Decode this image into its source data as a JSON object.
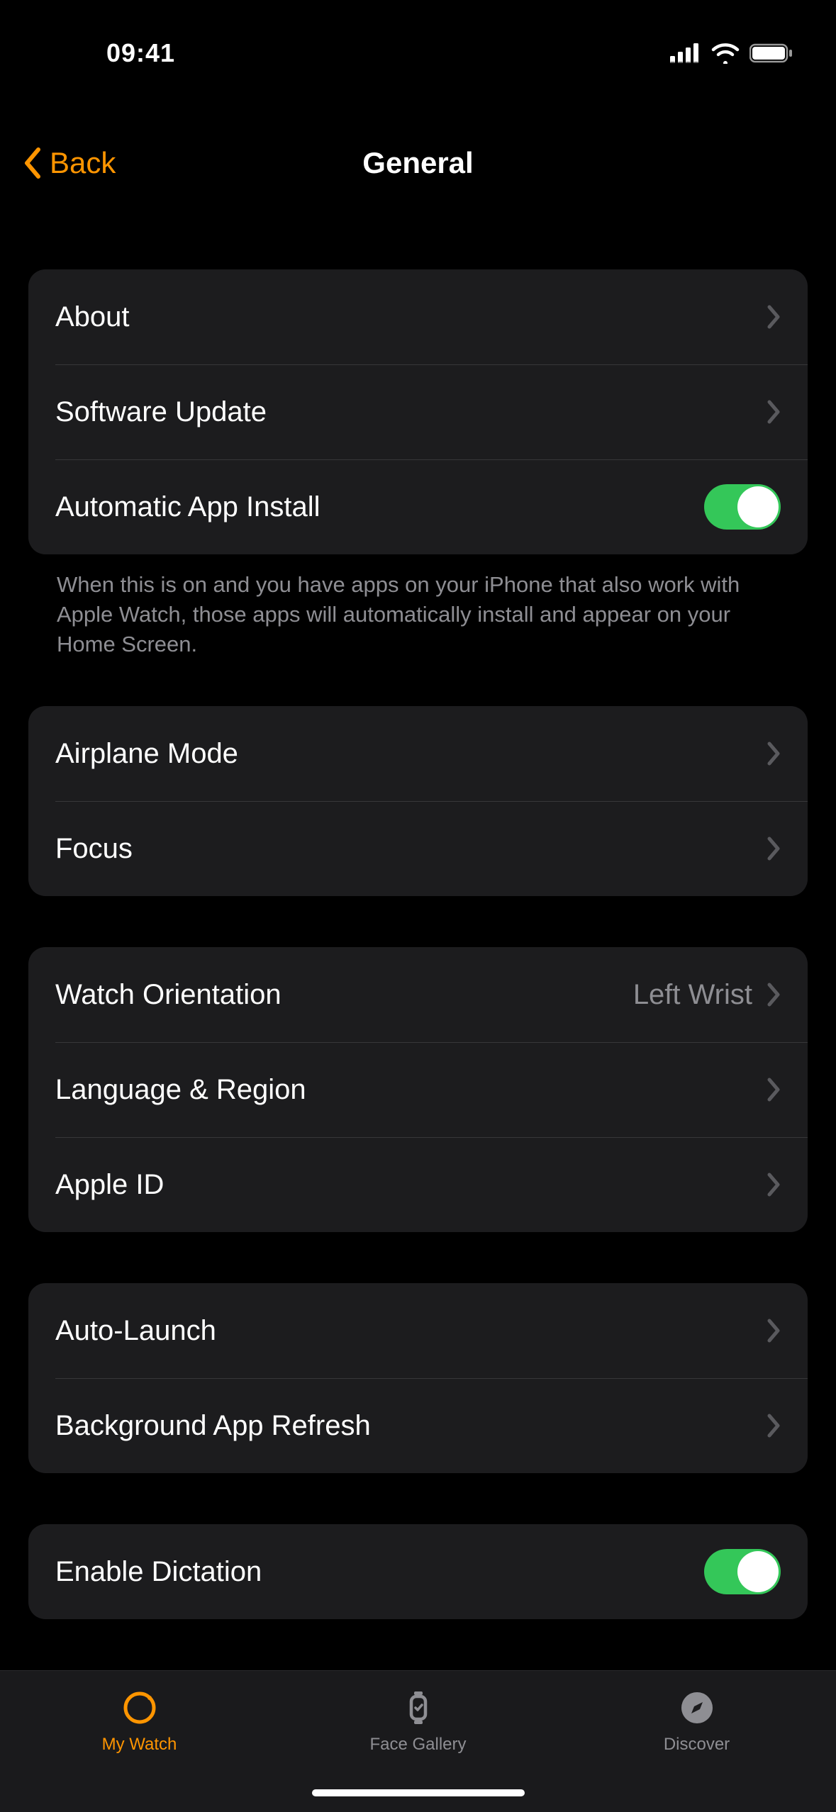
{
  "status": {
    "time": "09:41"
  },
  "nav": {
    "back": "Back",
    "title": "General"
  },
  "groups": [
    {
      "rows": [
        {
          "key": "about",
          "label": "About",
          "type": "nav"
        },
        {
          "key": "software-update",
          "label": "Software Update",
          "type": "nav"
        },
        {
          "key": "auto-app-install",
          "label": "Automatic App Install",
          "type": "toggle",
          "on": true
        }
      ],
      "footer": "When this is on and you have apps on your iPhone that also work with Apple Watch, those apps will automatically install and appear on your Home Screen."
    },
    {
      "rows": [
        {
          "key": "airplane-mode",
          "label": "Airplane Mode",
          "type": "nav"
        },
        {
          "key": "focus",
          "label": "Focus",
          "type": "nav"
        }
      ]
    },
    {
      "rows": [
        {
          "key": "watch-orientation",
          "label": "Watch Orientation",
          "type": "nav",
          "value": "Left Wrist"
        },
        {
          "key": "language-region",
          "label": "Language & Region",
          "type": "nav"
        },
        {
          "key": "apple-id",
          "label": "Apple ID",
          "type": "nav"
        }
      ]
    },
    {
      "rows": [
        {
          "key": "auto-launch",
          "label": "Auto-Launch",
          "type": "nav"
        },
        {
          "key": "bg-app-refresh",
          "label": "Background App Refresh",
          "type": "nav"
        }
      ]
    },
    {
      "rows": [
        {
          "key": "enable-dictation",
          "label": "Enable Dictation",
          "type": "toggle",
          "on": true
        }
      ]
    }
  ],
  "tabs": [
    {
      "key": "my-watch",
      "label": "My Watch",
      "active": true,
      "icon": "watch-icon"
    },
    {
      "key": "face-gallery",
      "label": "Face Gallery",
      "active": false,
      "icon": "face-gallery-icon"
    },
    {
      "key": "discover",
      "label": "Discover",
      "active": false,
      "icon": "compass-icon"
    }
  ]
}
